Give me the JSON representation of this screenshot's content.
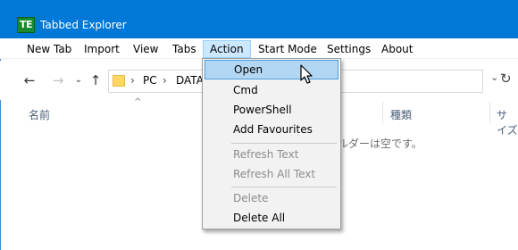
{
  "window": {
    "title": "Tabbed Explorer",
    "icon_text": "TE",
    "accent": "#0078d7"
  },
  "menubar": {
    "items": [
      "New Tab",
      "Import",
      "View",
      "Tabs",
      "Action",
      "Start Mode",
      "Settings",
      "About"
    ],
    "active_index": 4
  },
  "nav": {
    "back_icon": "arrow-left-icon",
    "forward_icon": "arrow-right-icon",
    "recent_icon": "chevron-down-icon",
    "up_icon": "arrow-up-icon",
    "refresh_icon": "refresh-icon"
  },
  "address": {
    "crumbs": [
      "PC",
      "DATA"
    ]
  },
  "columns": {
    "name": "名前",
    "type": "種類",
    "size": "サイズ"
  },
  "empty_message": "ルダーは空です。",
  "context_menu": {
    "items": [
      {
        "label": "Open",
        "state": "highlighted"
      },
      {
        "label": "Cmd",
        "state": "enabled"
      },
      {
        "label": "PowerShell",
        "state": "enabled"
      },
      {
        "label": "Add Favourites",
        "state": "enabled"
      },
      {
        "label": "Refresh Text",
        "state": "disabled"
      },
      {
        "label": "Refresh All Text",
        "state": "disabled"
      },
      {
        "label": "Delete",
        "state": "disabled"
      },
      {
        "label": "Delete All",
        "state": "enabled"
      }
    ]
  }
}
